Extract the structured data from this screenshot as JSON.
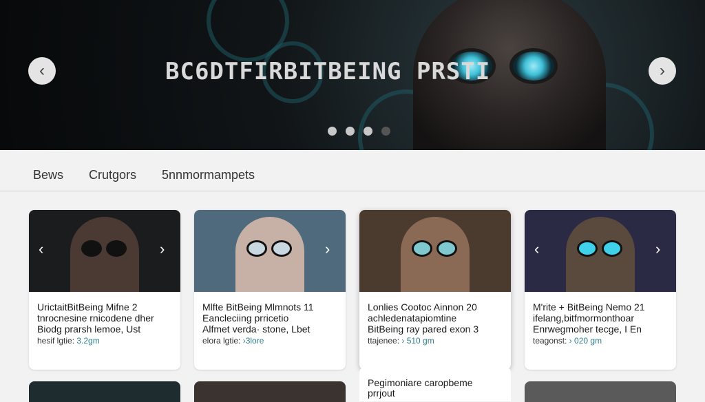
{
  "hero": {
    "title": "BC6DTFIRBITBEING PRSTI",
    "prev_arrow": "‹",
    "next_arrow": "›",
    "dots": 4,
    "active_dot": 3
  },
  "tabs": [
    {
      "label": "Bews"
    },
    {
      "label": "Crutgors"
    },
    {
      "label": "5nnmormampets"
    }
  ],
  "cards": [
    {
      "title": "UrictaitBitBeing Mifne 2",
      "line2": "tnrocnesine rnicodene dher",
      "line3": "Biodg prarsh lemoe, Ust",
      "meta": "hesif lgtie: ",
      "meta_accent": "3.2gm",
      "theme": {
        "bg": "#1b1c1e",
        "person": "#4a3a33",
        "eye": "#111111"
      }
    },
    {
      "title": "Mlfte BitBeing Mlmnots 11",
      "line2": "Eancleciing prricetio",
      "line3": "Alfmet verda· stone, Lbet",
      "meta": "elora lgtie: ",
      "meta_accent": "›3lore",
      "theme": {
        "bg": "#4f6a7d",
        "person": "#c7b0a5",
        "eye": "#c9d7e0"
      }
    },
    {
      "title": "Lonlies  Cootoc Ainnon 20",
      "line2": "achledenatapiomtine",
      "line3": "BitBeing ray pared  exon 3",
      "meta": "ttajenee: ",
      "meta_accent": "› 510 gm",
      "theme": {
        "bg": "#4b3a2e",
        "person": "#8b6a55",
        "eye": "#7fc8d0"
      }
    },
    {
      "title": "M'rite + BitBeing Nemo 21",
      "line2": "ifelang,bitfmormonthoar",
      "line3": "Enrwegmoher tecge, I En",
      "meta": "teagonst: ",
      "meta_accent": "› 020 gm",
      "theme": {
        "bg": "#2a2a45",
        "person": "#5a4a3d",
        "eye": "#3fd0ea"
      }
    }
  ],
  "partial_card": {
    "line1": "Pegimoniare caropbeme",
    "line2": "prrjout"
  },
  "colors": {
    "accent": "#2d7f8a",
    "page_bg": "#f2f2f3",
    "hero_lens": "#3fc0d8"
  }
}
